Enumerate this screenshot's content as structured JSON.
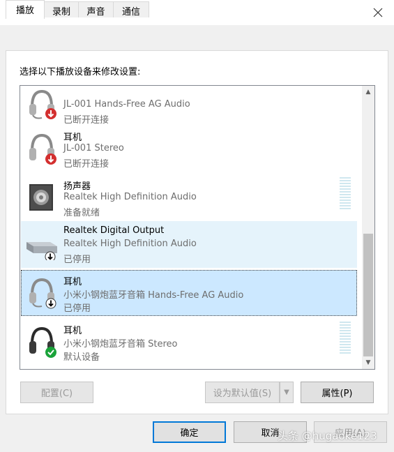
{
  "window": {
    "title": "声音"
  },
  "tabs": [
    {
      "label": "播放"
    },
    {
      "label": "录制"
    },
    {
      "label": "声音"
    },
    {
      "label": "通信"
    }
  ],
  "instruction": "选择以下播放设备来修改设置:",
  "devices": [
    {
      "name": "",
      "description": "JL-001 Hands-Free AG Audio",
      "status": "已断开连接",
      "icon": "headset-icon",
      "badge": "disconnected-badge"
    },
    {
      "name": "耳机",
      "description": "JL-001 Stereo",
      "status": "已断开连接",
      "icon": "headphones-icon",
      "badge": "disconnected-badge"
    },
    {
      "name": "扬声器",
      "description": "Realtek High Definition Audio",
      "status": "准备就绪",
      "icon": "speaker-icon",
      "badge": ""
    },
    {
      "name": "Realtek Digital Output",
      "description": "Realtek High Definition Audio",
      "status": "已停用",
      "icon": "digital-output-icon",
      "badge": "disabled-badge"
    },
    {
      "name": "耳机",
      "description": "小米小钢炮蓝牙音箱 Hands-Free AG Audio",
      "status": "已停用",
      "icon": "headset-icon",
      "badge": "disabled-badge"
    },
    {
      "name": "耳机",
      "description": "小米小钢炮蓝牙音箱 Stereo",
      "status": "默认设备",
      "icon": "headphones-icon",
      "badge": "default-check-badge"
    }
  ],
  "buttons": {
    "configure": "配置(C)",
    "set_default": "设为默认值(S)",
    "properties": "属性(P)",
    "ok": "确定",
    "cancel": "取消",
    "apply": "应用(A)"
  },
  "watermark": "头条 @hugaoke123",
  "colors": {
    "selected": "#cce8ff",
    "hover": "#e5f3fb",
    "accent": "#0078d7",
    "badge_red": "#d32f2f",
    "badge_green": "#1aa33a"
  }
}
